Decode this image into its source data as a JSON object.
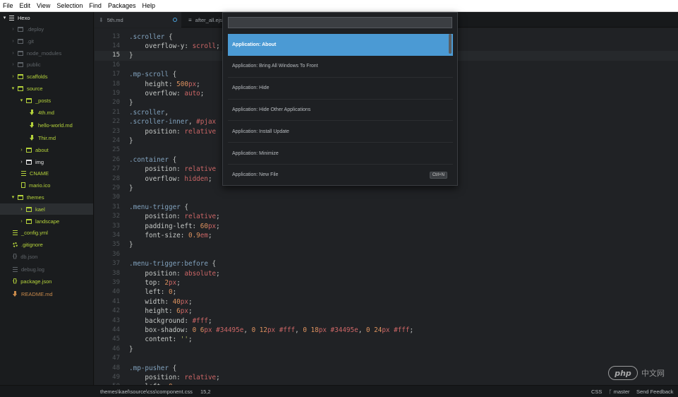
{
  "menubar": {
    "items": [
      "File",
      "Edit",
      "View",
      "Selection",
      "Find",
      "Packages",
      "Help"
    ]
  },
  "tree": {
    "items": [
      {
        "label": "Hexo",
        "icon": "project-icon",
        "chevron": "down",
        "color": "white"
      },
      {
        "label": ".deploy",
        "icon": "folder-icon",
        "chevron": "right",
        "color": "dim"
      },
      {
        "label": ".git",
        "icon": "folder-icon",
        "chevron": "right",
        "color": "dim"
      },
      {
        "label": "node_modules",
        "icon": "folder-icon",
        "chevron": "right",
        "color": "dim"
      },
      {
        "label": "public",
        "icon": "folder-icon",
        "chevron": "right",
        "color": "dim"
      },
      {
        "label": "scaffolds",
        "icon": "folder-icon",
        "chevron": "right",
        "color": "green"
      },
      {
        "label": "source",
        "icon": "folder-icon",
        "chevron": "down",
        "color": "green"
      },
      {
        "label": "_posts",
        "icon": "folder-icon",
        "chevron": "down",
        "color": "green"
      },
      {
        "label": "4th.md",
        "icon": "markdown-icon",
        "chevron": "",
        "color": "green"
      },
      {
        "label": "hello-world.md",
        "icon": "markdown-icon",
        "chevron": "",
        "color": "green"
      },
      {
        "label": "Thir.md",
        "icon": "markdown-icon",
        "chevron": "",
        "color": "green"
      },
      {
        "label": "about",
        "icon": "folder-icon",
        "chevron": "right",
        "color": "green"
      },
      {
        "label": "img",
        "icon": "folder-icon",
        "chevron": "right",
        "color": "white"
      },
      {
        "label": "CNAME",
        "icon": "text-file-icon",
        "chevron": "",
        "color": "green"
      },
      {
        "label": "mario.ico",
        "icon": "file-icon",
        "chevron": "",
        "color": "green"
      },
      {
        "label": "themes",
        "icon": "folder-icon",
        "chevron": "down",
        "color": "green"
      },
      {
        "label": "kael",
        "icon": "folder-icon",
        "chevron": "right",
        "color": "green"
      },
      {
        "label": "landscape",
        "icon": "folder-icon",
        "chevron": "right",
        "color": "green"
      },
      {
        "label": "_config.yml",
        "icon": "text-file-icon",
        "chevron": "",
        "color": "green"
      },
      {
        "label": ".gitignore",
        "icon": "gear-icon",
        "chevron": "",
        "color": "green"
      },
      {
        "label": "db.json",
        "icon": "braces-icon",
        "chevron": "",
        "color": "dim"
      },
      {
        "label": "debug.log",
        "icon": "text-file-icon",
        "chevron": "",
        "color": "dim"
      },
      {
        "label": "package.json",
        "icon": "braces-icon",
        "chevron": "",
        "color": "green"
      },
      {
        "label": "README.md",
        "icon": "markdown-icon",
        "chevron": "",
        "color": "orange"
      }
    ]
  },
  "tabs": [
    {
      "label": "5th.md",
      "icon": "markdown-icon",
      "modified": true
    },
    {
      "label": "after_all.ejs",
      "icon": "text-file-icon",
      "modified": false
    }
  ],
  "editor": {
    "current_line": 15,
    "lines": [
      {
        "n": "13",
        "parts": [
          [
            ".scroller",
            "sel"
          ],
          [
            " {",
            "pun"
          ]
        ]
      },
      {
        "n": "14",
        "parts": [
          [
            "    overflow-y: ",
            "prop"
          ],
          [
            "scroll",
            "kw"
          ],
          [
            ";",
            "pun"
          ]
        ]
      },
      {
        "n": "15",
        "parts": [
          [
            "}",
            "pun"
          ]
        ]
      },
      {
        "n": "16",
        "parts": []
      },
      {
        "n": "17",
        "parts": [
          [
            ".mp-scroll",
            "sel"
          ],
          [
            " {",
            "pun"
          ]
        ]
      },
      {
        "n": "18",
        "parts": [
          [
            "    height: ",
            "prop"
          ],
          [
            "500",
            "num"
          ],
          [
            "px",
            "kw"
          ],
          [
            ";",
            "pun"
          ]
        ]
      },
      {
        "n": "19",
        "parts": [
          [
            "    overflow: ",
            "prop"
          ],
          [
            "auto",
            "kw"
          ],
          [
            ";",
            "pun"
          ]
        ]
      },
      {
        "n": "20",
        "parts": [
          [
            "}",
            "pun"
          ]
        ]
      },
      {
        "n": "21",
        "parts": [
          [
            ".scroller",
            "sel"
          ],
          [
            ",",
            "pun"
          ]
        ]
      },
      {
        "n": "22",
        "parts": [
          [
            ".scroller-inner",
            "sel"
          ],
          [
            ", ",
            "pun"
          ],
          [
            "#pjax",
            "kw"
          ]
        ]
      },
      {
        "n": "23",
        "parts": [
          [
            "    position: ",
            "prop"
          ],
          [
            "relative",
            "kw"
          ]
        ]
      },
      {
        "n": "24",
        "parts": [
          [
            "}",
            "pun"
          ]
        ]
      },
      {
        "n": "25",
        "parts": []
      },
      {
        "n": "26",
        "parts": [
          [
            ".container",
            "sel"
          ],
          [
            " {",
            "pun"
          ]
        ]
      },
      {
        "n": "27",
        "parts": [
          [
            "    position: ",
            "prop"
          ],
          [
            "relative",
            "kw"
          ]
        ]
      },
      {
        "n": "28",
        "parts": [
          [
            "    overflow: ",
            "prop"
          ],
          [
            "hidden",
            "kw"
          ],
          [
            ";",
            "pun"
          ]
        ]
      },
      {
        "n": "29",
        "parts": [
          [
            "}",
            "pun"
          ]
        ]
      },
      {
        "n": "30",
        "parts": []
      },
      {
        "n": "31",
        "parts": [
          [
            ".menu-trigger",
            "sel"
          ],
          [
            " {",
            "pun"
          ]
        ]
      },
      {
        "n": "32",
        "parts": [
          [
            "    position: ",
            "prop"
          ],
          [
            "relative",
            "kw"
          ],
          [
            ";",
            "pun"
          ]
        ]
      },
      {
        "n": "33",
        "parts": [
          [
            "    padding-left: ",
            "prop"
          ],
          [
            "60",
            "num"
          ],
          [
            "px",
            "kw"
          ],
          [
            ";",
            "pun"
          ]
        ]
      },
      {
        "n": "34",
        "parts": [
          [
            "    font-size: ",
            "prop"
          ],
          [
            "0.9",
            "num"
          ],
          [
            "em",
            "kw"
          ],
          [
            ";",
            "pun"
          ]
        ]
      },
      {
        "n": "35",
        "parts": [
          [
            "}",
            "pun"
          ]
        ]
      },
      {
        "n": "36",
        "parts": []
      },
      {
        "n": "37",
        "parts": [
          [
            ".menu-trigger:before",
            "sel"
          ],
          [
            " {",
            "pun"
          ]
        ]
      },
      {
        "n": "38",
        "parts": [
          [
            "    position: ",
            "prop"
          ],
          [
            "absolute",
            "kw"
          ],
          [
            ";",
            "pun"
          ]
        ]
      },
      {
        "n": "39",
        "parts": [
          [
            "    top: ",
            "prop"
          ],
          [
            "2",
            "num"
          ],
          [
            "px",
            "kw"
          ],
          [
            ";",
            "pun"
          ]
        ]
      },
      {
        "n": "40",
        "parts": [
          [
            "    left: ",
            "prop"
          ],
          [
            "0",
            "num"
          ],
          [
            ";",
            "pun"
          ]
        ]
      },
      {
        "n": "41",
        "parts": [
          [
            "    width: ",
            "prop"
          ],
          [
            "40",
            "num"
          ],
          [
            "px",
            "kw"
          ],
          [
            ";",
            "pun"
          ]
        ]
      },
      {
        "n": "42",
        "parts": [
          [
            "    height: ",
            "prop"
          ],
          [
            "6",
            "num"
          ],
          [
            "px",
            "kw"
          ],
          [
            ";",
            "pun"
          ]
        ]
      },
      {
        "n": "43",
        "parts": [
          [
            "    background: ",
            "prop"
          ],
          [
            "#fff",
            "hx"
          ],
          [
            ";",
            "pun"
          ]
        ]
      },
      {
        "n": "44",
        "parts": [
          [
            "    box-shadow: ",
            "prop"
          ],
          [
            "0 ",
            "num"
          ],
          [
            "6",
            "num"
          ],
          [
            "px ",
            "kw"
          ],
          [
            "#34495e",
            "hx"
          ],
          [
            ", ",
            "pun"
          ],
          [
            "0 12",
            "num"
          ],
          [
            "px ",
            "kw"
          ],
          [
            "#fff",
            "hx"
          ],
          [
            ", ",
            "pun"
          ],
          [
            "0 18",
            "num"
          ],
          [
            "px ",
            "kw"
          ],
          [
            "#34495e",
            "hx"
          ],
          [
            ", ",
            "pun"
          ],
          [
            "0 24",
            "num"
          ],
          [
            "px ",
            "kw"
          ],
          [
            "#fff",
            "hx"
          ],
          [
            ";",
            "pun"
          ]
        ]
      },
      {
        "n": "45",
        "parts": [
          [
            "    content: ",
            "prop"
          ],
          [
            "''",
            "str"
          ],
          [
            ";",
            "pun"
          ]
        ]
      },
      {
        "n": "46",
        "parts": [
          [
            "}",
            "pun"
          ]
        ]
      },
      {
        "n": "47",
        "parts": []
      },
      {
        "n": "48",
        "parts": [
          [
            ".mp-pusher",
            "sel"
          ],
          [
            " {",
            "pun"
          ]
        ]
      },
      {
        "n": "49",
        "parts": [
          [
            "    position: ",
            "prop"
          ],
          [
            "relative",
            "kw"
          ],
          [
            ";",
            "pun"
          ]
        ]
      },
      {
        "n": "50",
        "parts": [
          [
            "    left: ",
            "prop"
          ],
          [
            "0",
            "num"
          ],
          [
            ";",
            "pun"
          ]
        ]
      }
    ]
  },
  "palette": {
    "query": "",
    "items": [
      {
        "label": "Application: About",
        "active": true,
        "shortcut": ""
      },
      {
        "label": "Application: Bring All Windows To Front",
        "active": false,
        "shortcut": ""
      },
      {
        "label": "Application: Hide",
        "active": false,
        "shortcut": ""
      },
      {
        "label": "Application: Hide Other Applications",
        "active": false,
        "shortcut": ""
      },
      {
        "label": "Application: Install Update",
        "active": false,
        "shortcut": ""
      },
      {
        "label": "Application: Minimize",
        "active": false,
        "shortcut": ""
      },
      {
        "label": "Application: New File",
        "active": false,
        "shortcut": "Ctrl+N"
      }
    ]
  },
  "status": {
    "path": "themes\\kael\\source\\css\\component.css",
    "cursor": "15,2",
    "grammar": "CSS",
    "branch": "master",
    "feedback": "Send Feedback"
  },
  "watermark": {
    "logo": "php",
    "text": "中文网"
  },
  "colors": {
    "accent": "#4b9ad4",
    "tree_green": "#b5d33b",
    "editor_bg": "#202225"
  }
}
